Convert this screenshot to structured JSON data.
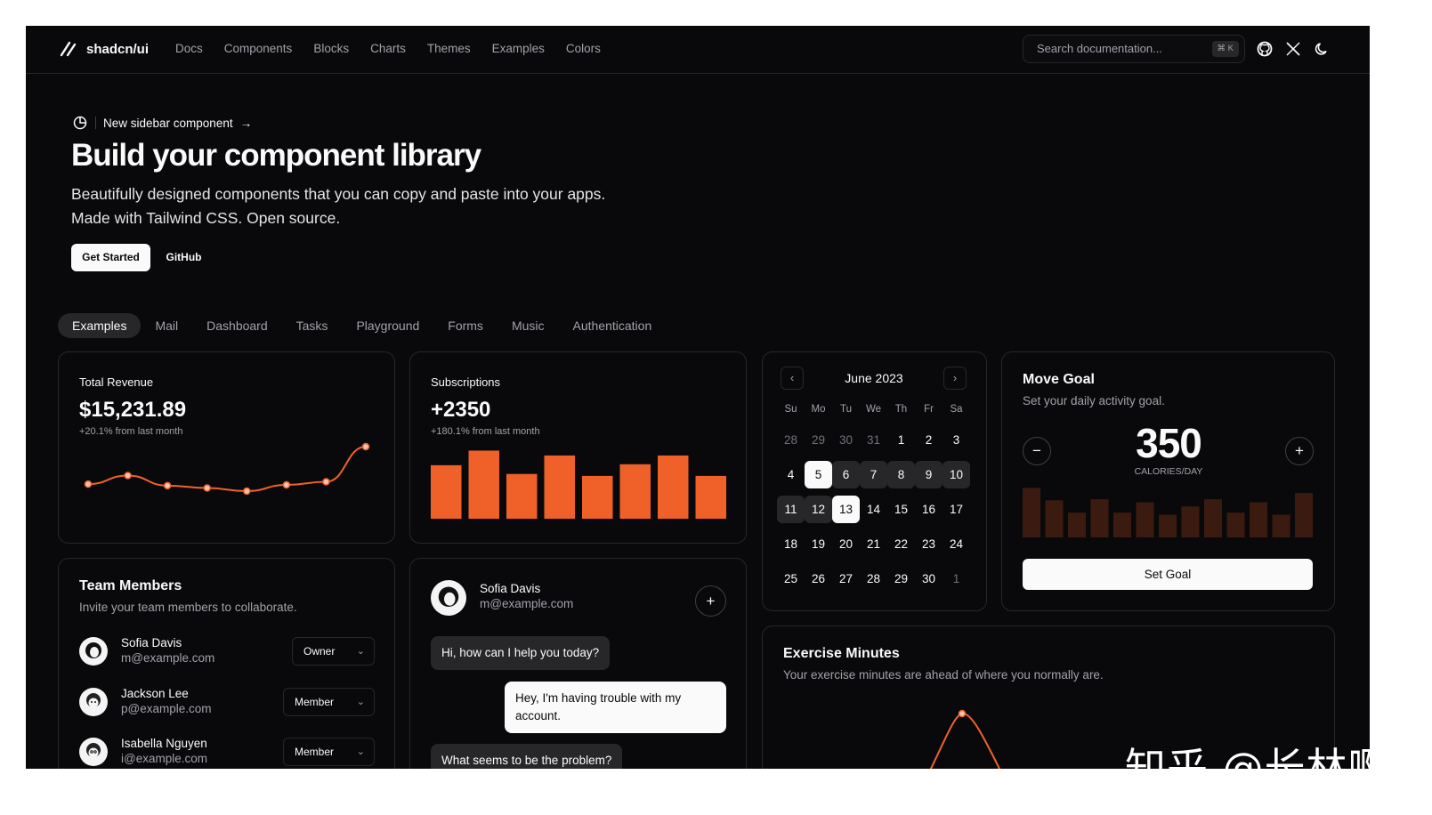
{
  "nav": {
    "brand": "shadcn/ui",
    "links": [
      "Docs",
      "Components",
      "Blocks",
      "Charts",
      "Themes",
      "Examples",
      "Colors"
    ],
    "search_placeholder": "Search documentation...",
    "search_shortcut": "⌘ K"
  },
  "hero": {
    "announcement": "New sidebar component",
    "announcement_arrow": "→",
    "title": "Build your component library",
    "subtitle_line1": "Beautifully designed components that you can copy and paste into your apps.",
    "subtitle_line2": "Made with Tailwind CSS. Open source.",
    "primary_button": "Get Started",
    "secondary_button": "GitHub"
  },
  "tabs": [
    "Examples",
    "Mail",
    "Dashboard",
    "Tasks",
    "Playground",
    "Forms",
    "Music",
    "Authentication"
  ],
  "revenue": {
    "label": "Total Revenue",
    "value": "$15,231.89",
    "change": "+20.1% from last month"
  },
  "subscriptions": {
    "label": "Subscriptions",
    "value": "+2350",
    "change": "+180.1% from last month"
  },
  "calendar": {
    "month": "June 2023",
    "prev_icon": "‹",
    "next_icon": "›",
    "dow": [
      "Su",
      "Mo",
      "Tu",
      "We",
      "Th",
      "Fr",
      "Sa"
    ],
    "weeks": [
      [
        "28",
        "29",
        "30",
        "31",
        "1",
        "2",
        "3"
      ],
      [
        "4",
        "5",
        "6",
        "7",
        "8",
        "9",
        "10"
      ],
      [
        "11",
        "12",
        "13",
        "14",
        "15",
        "16",
        "17"
      ],
      [
        "18",
        "19",
        "20",
        "21",
        "22",
        "23",
        "24"
      ],
      [
        "25",
        "26",
        "27",
        "28",
        "29",
        "30",
        "1"
      ]
    ],
    "selected": [
      "5",
      "13"
    ],
    "range_start": "5",
    "range_end": "13"
  },
  "move_goal": {
    "title": "Move Goal",
    "description": "Set your daily activity goal.",
    "value": "350",
    "unit": "CALORIES/DAY",
    "minus_icon": "−",
    "plus_icon": "+",
    "button": "Set Goal"
  },
  "team": {
    "title": "Team Members",
    "description": "Invite your team members to collaborate.",
    "members": [
      {
        "name": "Sofia Davis",
        "email": "m@example.com",
        "role": "Owner"
      },
      {
        "name": "Jackson Lee",
        "email": "p@example.com",
        "role": "Member"
      },
      {
        "name": "Isabella Nguyen",
        "email": "i@example.com",
        "role": "Member"
      }
    ],
    "chevron_icon": "⌄"
  },
  "chat": {
    "name": "Sofia Davis",
    "email": "m@example.com",
    "add_icon": "+",
    "messages": [
      {
        "from": "them",
        "text": "Hi, how can I help you today?"
      },
      {
        "from": "me",
        "text": "Hey, I'm having trouble with my account."
      },
      {
        "from": "them",
        "text": "What seems to be the problem?"
      }
    ]
  },
  "exercise": {
    "title": "Exercise Minutes",
    "description": "Your exercise minutes are ahead of where you normally are."
  },
  "watermark": "知乎 @长林啊",
  "colors": {
    "accent": "#f0612a",
    "accent_dim": "#3b1a10",
    "background": "#09090b",
    "border": "#27272a"
  },
  "chart_data": [
    {
      "type": "line",
      "x": [
        1,
        2,
        3,
        4,
        5,
        6,
        7,
        8
      ],
      "values": [
        1.0,
        2.1,
        0.8,
        0.5,
        0.1,
        0.9,
        1.3,
        5.8
      ],
      "title": "",
      "xlabel": "",
      "ylabel": ""
    },
    {
      "type": "bar",
      "categories": [
        "1",
        "2",
        "3",
        "4",
        "5",
        "6",
        "7",
        "8",
        "9",
        "10"
      ],
      "values": [
        55,
        70,
        46,
        65,
        44,
        56,
        65,
        44
      ],
      "title": "",
      "xlabel": "",
      "ylabel": ""
    },
    {
      "type": "bar",
      "categories": [
        "1",
        "2",
        "3",
        "4",
        "5",
        "6",
        "7",
        "8",
        "9",
        "10",
        "11",
        "12",
        "13"
      ],
      "values": [
        48,
        36,
        24,
        37,
        24,
        34,
        22,
        30,
        37,
        24,
        34,
        22,
        43
      ],
      "title": "",
      "xlabel": "",
      "ylabel": ""
    },
    {
      "type": "line",
      "x": [
        1,
        2,
        3
      ],
      "values": [
        0,
        1,
        0
      ],
      "title": "",
      "xlabel": "",
      "ylabel": ""
    }
  ]
}
